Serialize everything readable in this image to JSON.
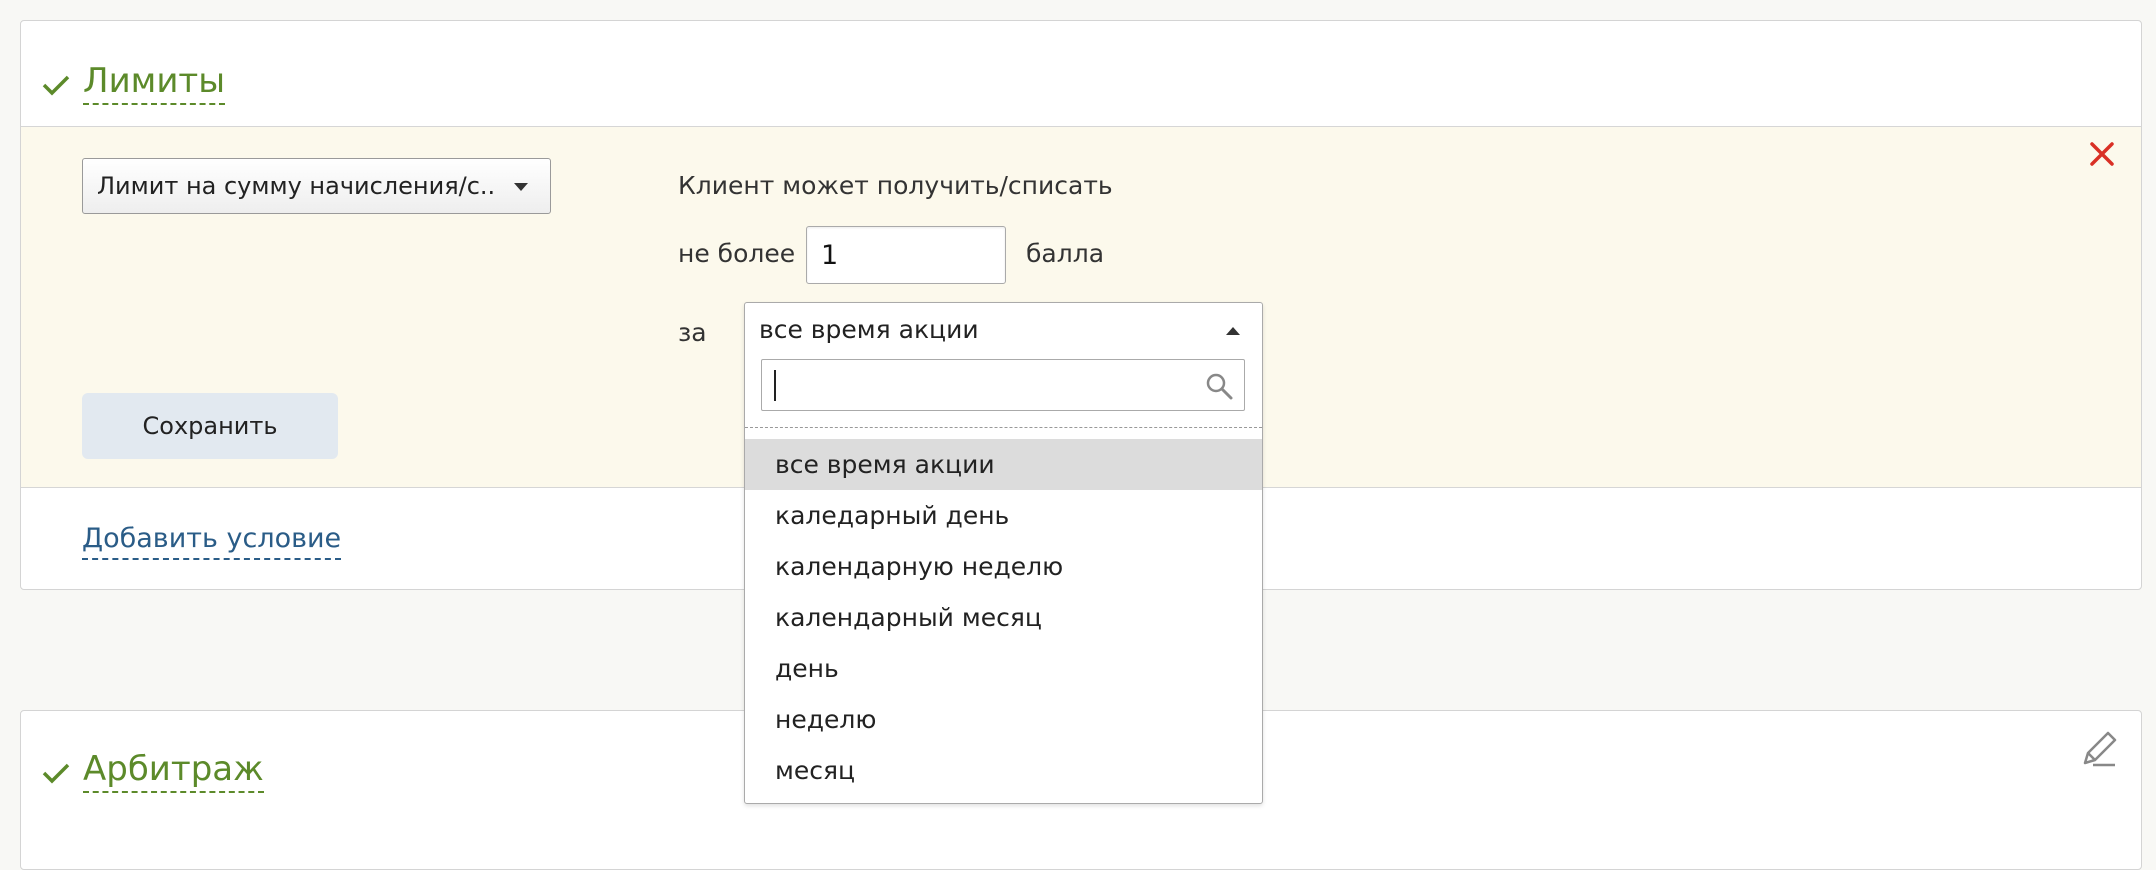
{
  "limits_section": {
    "title": "Лимиты",
    "limit_type": "Лимит на сумму начисления/с...",
    "client_text": "Клиент может получить/списать",
    "not_more_label": "не более",
    "amount_value": "1",
    "points_label": "балла",
    "for_label": "за",
    "period_selected": "все время акции",
    "save_label": "Сохранить",
    "add_condition_label": "Добавить условие"
  },
  "period_dropdown": {
    "search_value": "",
    "options": [
      "все время акции",
      "каледарный день",
      "календарную неделю",
      "календарный месяц",
      "день",
      "неделю",
      "месяц"
    ],
    "highlighted_index": 0
  },
  "arbitrage_section": {
    "title": "Арбитраж"
  },
  "colors": {
    "section_title": "#5c8a2a",
    "link": "#2a5c87",
    "close_icon": "#d93025",
    "edit_panel_bg": "#fcf9ec",
    "highlight": "#dcdcdc"
  },
  "icons": [
    "check-icon",
    "chevron-down-icon",
    "close-icon",
    "search-icon",
    "pencil-icon"
  ]
}
